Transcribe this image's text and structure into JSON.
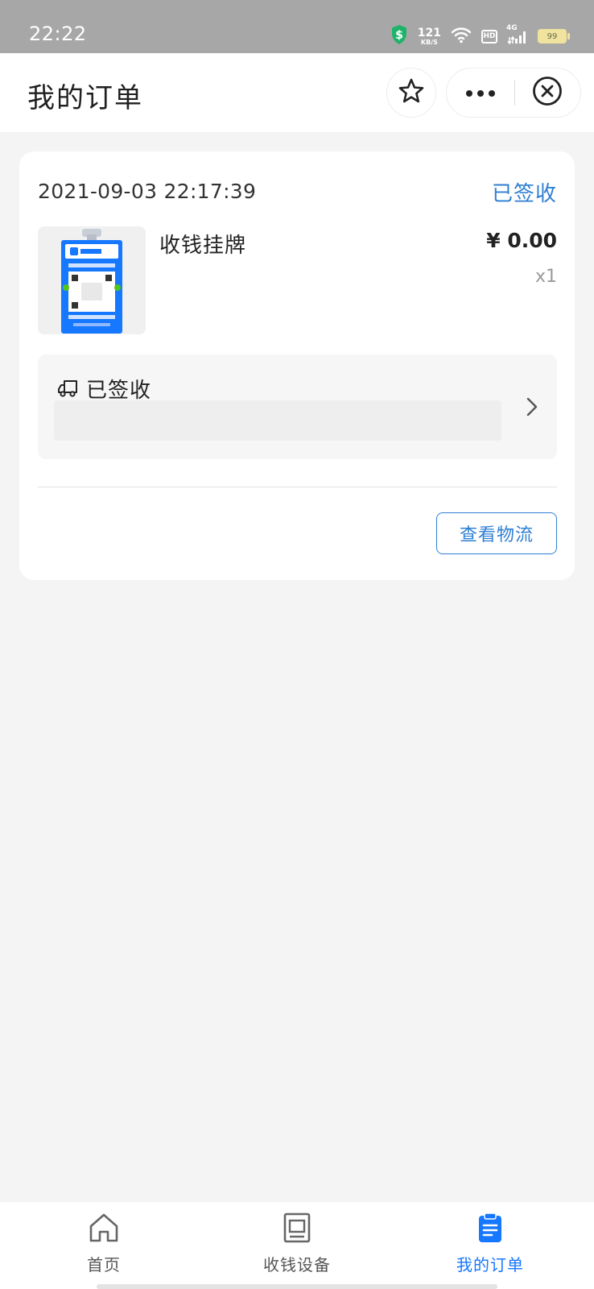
{
  "status_bar": {
    "time": "22:22",
    "net_speed_value": "121",
    "net_speed_unit": "KB/S",
    "hd_label": "HD",
    "network_type": "4G",
    "battery_level": "99",
    "icons": [
      "shield-dollar-icon",
      "wifi-icon",
      "hd-icon",
      "signal-icon",
      "battery-icon"
    ]
  },
  "header": {
    "title": "我的订单",
    "buttons": [
      "star-icon",
      "more-dots-icon",
      "close-circle-icon"
    ]
  },
  "order": {
    "time": "2021-09-03 22:17:39",
    "status": "已签收",
    "product": {
      "name": "收钱挂牌",
      "price": "¥ 0.00",
      "quantity": "x1"
    },
    "logistics": {
      "status": "已签收"
    },
    "track_button_label": "查看物流"
  },
  "tab_bar": {
    "active": "我的订单",
    "items": [
      {
        "label": "首页",
        "icon": "home-icon"
      },
      {
        "label": "收钱设备",
        "icon": "device-icon"
      },
      {
        "label": "我的订单",
        "icon": "clipboard-icon"
      }
    ]
  },
  "colors": {
    "accent": "#2f7fd2",
    "tab_active": "#1677ff",
    "page_background": "#f4f4f4",
    "status_bar": "#a7a7a7"
  }
}
